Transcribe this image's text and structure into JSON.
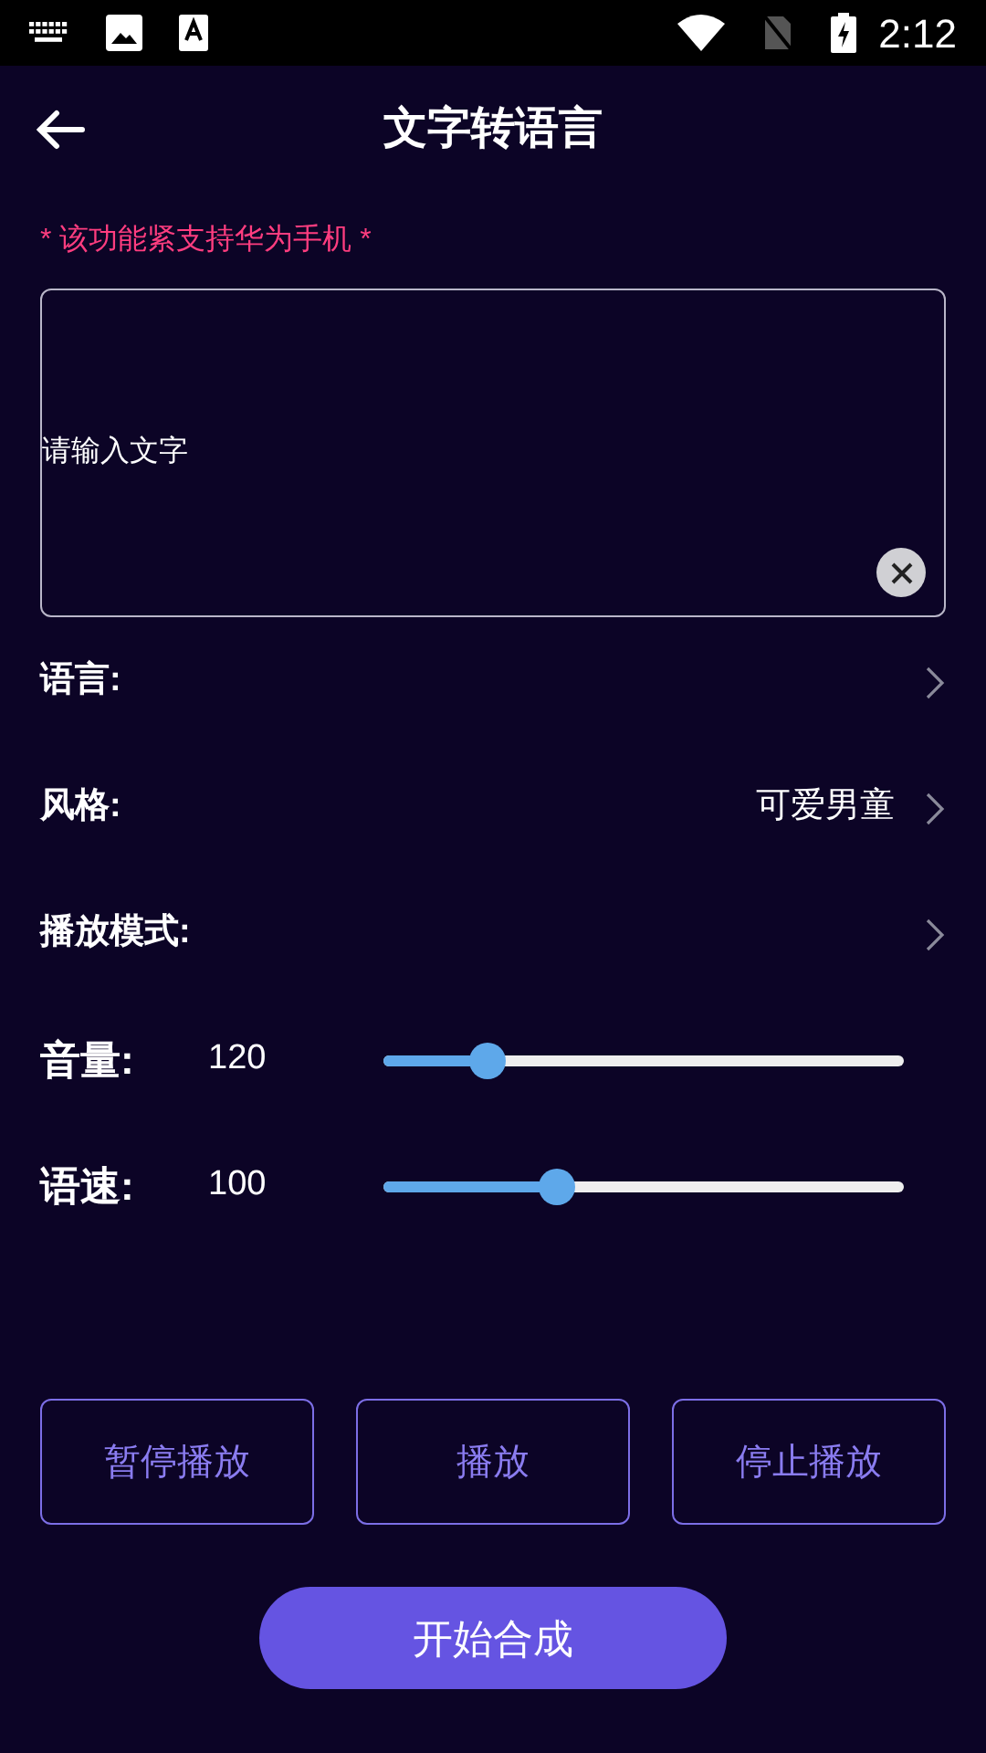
{
  "status_bar": {
    "time": "2:12"
  },
  "header": {
    "title": "文字转语言"
  },
  "notice": "* 该功能紧支持华为手机 *",
  "text_input": {
    "placeholder": "请输入文字"
  },
  "options": [
    {
      "label": "语言:"
    },
    {
      "label": "风格:",
      "value": "可爱男童"
    },
    {
      "label": "播放模式:"
    }
  ],
  "sliders": [
    {
      "label": "音量:",
      "reading": "120",
      "level": 0.2
    },
    {
      "label": "语速:",
      "reading": "100",
      "level": 0.333
    }
  ],
  "buttons": [
    "暂停播放",
    "播放",
    "停止播放"
  ],
  "primary_button": "开始合成"
}
